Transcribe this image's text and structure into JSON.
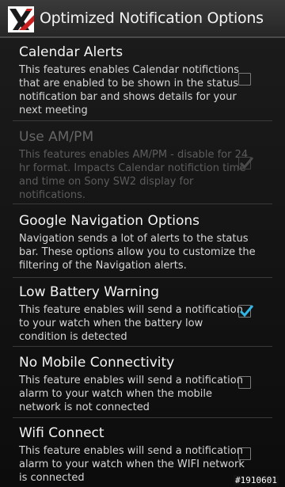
{
  "action_bar": {
    "title": "Optimized Notification Options",
    "icon": "app-logo-icon"
  },
  "preferences": [
    {
      "title": "Calendar Alerts",
      "summary": "This features enables Calendar notifictions that are enabled to be shown in the status notification bar and shows details for your next meeting",
      "checked": false,
      "enabled": true
    },
    {
      "title": "Use AM/PM",
      "summary": "This features enables AM/PM - disable for 24 hr format. Impacts Calendar notifiction time and time on Sony SW2 display for notifications.",
      "checked": true,
      "enabled": false
    },
    {
      "title": "Google Navigation Options",
      "summary": "Navigation sends a lot of alerts to the status bar. These options allow you to customize the filtering of the Navigation alerts."
    },
    {
      "title": "Low Battery Warning",
      "summary": "This feature enables will send a notification  to your watch when the battery low condition is detected",
      "checked": true,
      "enabled": true
    },
    {
      "title": "No Mobile Connectivity",
      "summary": "This feature enables will send a notification alarm to your watch when the mobile network is not connected",
      "checked": false,
      "enabled": true
    },
    {
      "title": "Wifi Connect",
      "summary": "This feature enables will send a notification alarm to your watch when the WIFI network is connected",
      "checked": false,
      "enabled": true
    }
  ],
  "watermark": "#1910601",
  "colors": {
    "accent": "#33b5e5",
    "background": "#000000",
    "divider": "#3a3a3a"
  }
}
